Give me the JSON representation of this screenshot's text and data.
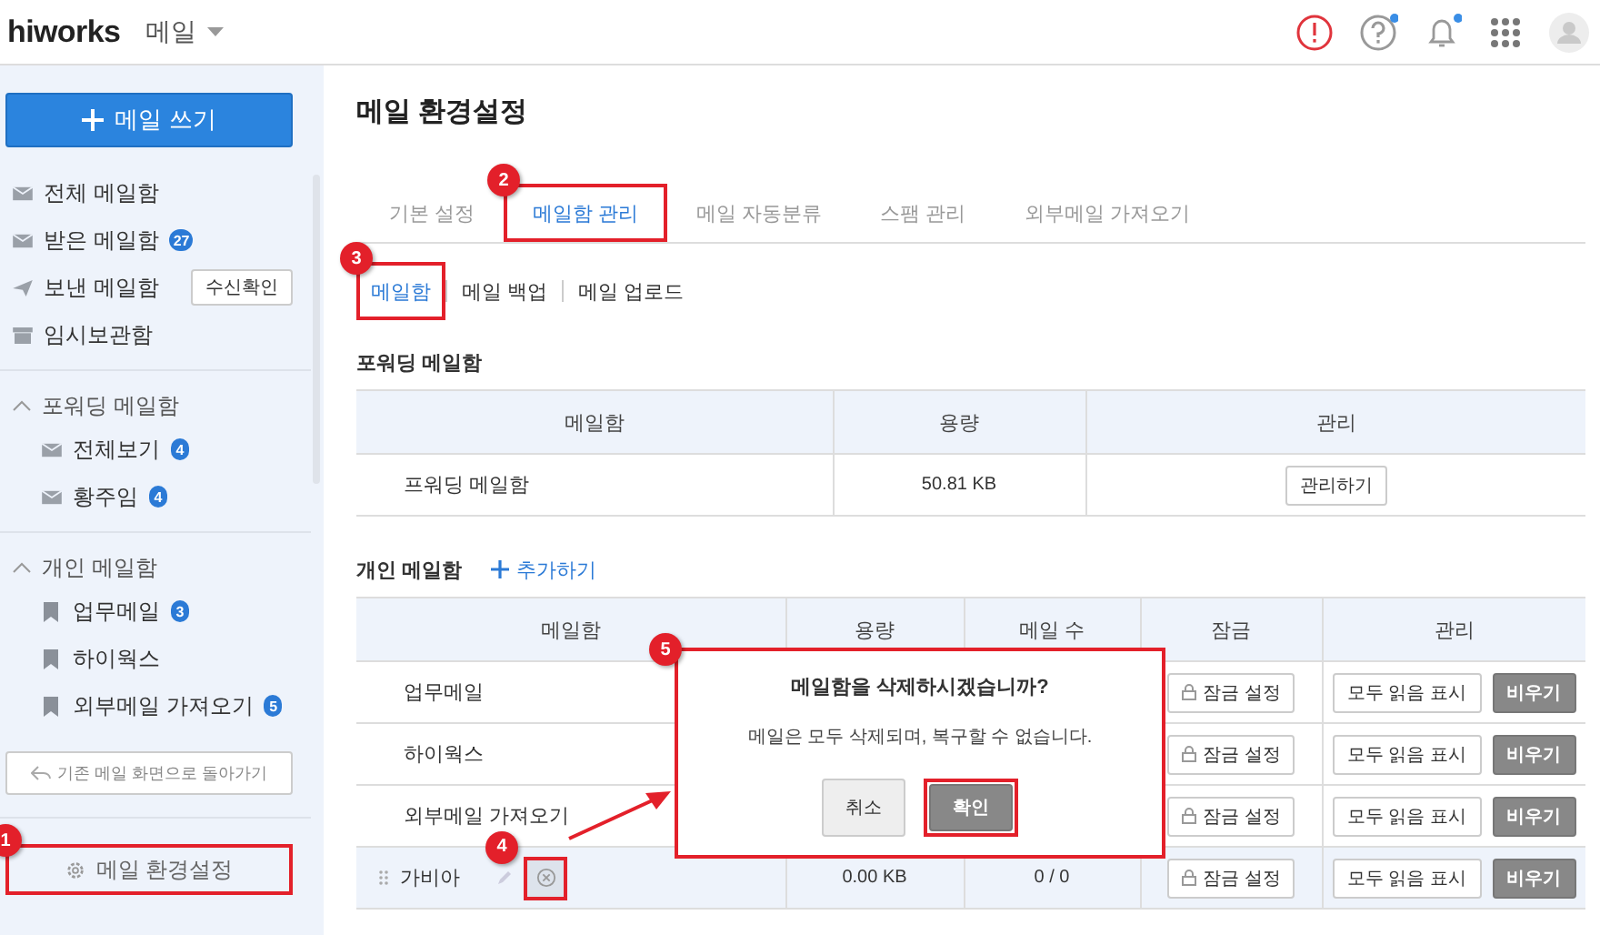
{
  "header": {
    "logo": "hiworks",
    "app_menu": "메일",
    "icons": [
      {
        "kind": "alert",
        "dot": false
      },
      {
        "kind": "help",
        "dot": true
      },
      {
        "kind": "bell",
        "dot": true
      },
      {
        "kind": "apps",
        "dot": false
      },
      {
        "kind": "avatar",
        "dot": false
      }
    ]
  },
  "sidebar": {
    "compose": "메일 쓰기",
    "items": [
      {
        "kind": "mail",
        "label": "전체 메일함"
      },
      {
        "kind": "mail",
        "label": "받은 메일함",
        "badge": "27"
      },
      {
        "kind": "send",
        "label": "보낸 메일함",
        "button": "수신확인"
      },
      {
        "kind": "archive",
        "label": "임시보관함"
      }
    ],
    "sections": [
      {
        "title": "포워딩 메일함",
        "expanded": true,
        "items": [
          {
            "kind": "mail",
            "label": "전체보기",
            "badge": "4"
          },
          {
            "kind": "mail",
            "label": "황주임",
            "badge": "4"
          }
        ]
      },
      {
        "title": "개인 메일함",
        "expanded": true,
        "items": [
          {
            "kind": "bookmark",
            "label": "업무메일",
            "badge": "3"
          },
          {
            "kind": "bookmark",
            "label": "하이웍스"
          },
          {
            "kind": "bookmark",
            "label": "외부메일 가져오기",
            "badge": "5"
          }
        ]
      }
    ],
    "back_button": "기존 메일 화면으로 돌아가기",
    "settings": {
      "label": "메일 환경설정",
      "callout": "1"
    }
  },
  "page": {
    "title": "메일 환경설정",
    "tabs": [
      {
        "label": "기본 설정",
        "selected": false
      },
      {
        "label": "메일함 관리",
        "selected": true,
        "callout": "2"
      },
      {
        "label": "메일 자동분류",
        "selected": false
      },
      {
        "label": "스팸 관리",
        "selected": false
      },
      {
        "label": "외부메일 가져오기",
        "selected": false
      }
    ],
    "subtabs": [
      {
        "label": "메일함",
        "selected": true,
        "callout": "3"
      },
      {
        "label": "메일 백업",
        "selected": false
      },
      {
        "label": "메일 업로드",
        "selected": false
      }
    ],
    "forwarding": {
      "title": "포워딩 메일함",
      "columns": [
        "메일함",
        "용량",
        "관리"
      ],
      "rows": [
        {
          "name": "프워딩 메일함",
          "size": "50.81 KB",
          "action": "관리하기"
        }
      ]
    },
    "personal": {
      "title": "개인 메일함",
      "add": "추가하기",
      "columns": [
        "메일함",
        "용량",
        "메일 수",
        "잠금",
        "관리"
      ],
      "rows": [
        {
          "name": "업무메일",
          "selected": false,
          "lock": "잠금 설정",
          "mark_read": "모두 읽음 표시",
          "empty": "비우기"
        },
        {
          "name": "하이웍스",
          "selected": false,
          "lock": "잠금 설정",
          "mark_read": "모두 읽음 표시",
          "empty": "비우기"
        },
        {
          "name": "외부메일 가져오기",
          "selected": false,
          "lock": "잠금 설정",
          "mark_read": "모두 읽음 표시",
          "empty": "비우기"
        },
        {
          "name": "가비아",
          "selected": true,
          "delete_callout": "4",
          "size": "0.00 KB",
          "count": "0 / 0",
          "lock": "잠금 설정",
          "mark_read": "모두 읽음 표시",
          "empty": "비우기"
        }
      ]
    },
    "dialog": {
      "callout": "5",
      "title": "메일함을 삭제하시겠습니까?",
      "message": "메일은 모두 삭제되며, 복구할 수 없습니다.",
      "cancel": "취소",
      "confirm": "확인",
      "confirm_callout": true
    }
  }
}
